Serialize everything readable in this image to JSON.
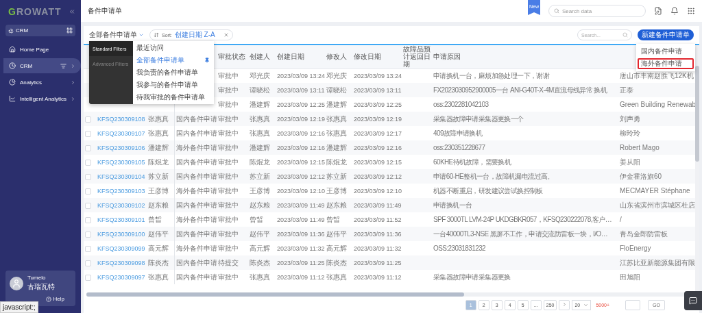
{
  "sidebar": {
    "logo_initial": "G",
    "logo_rest": "ROWATT",
    "workspace": "CRM",
    "nav": [
      {
        "label": "Home Page",
        "selected": false,
        "submenu": false
      },
      {
        "label": "CRM",
        "selected": true,
        "submenu": true
      },
      {
        "label": "Analytics",
        "selected": false,
        "submenu": true
      },
      {
        "label": "Intelligent Analytics",
        "selected": false,
        "submenu": true
      }
    ],
    "user": {
      "name": "Tumelo",
      "company": "古瑞瓦特"
    },
    "help": "Help"
  },
  "header": {
    "title": "备件申请单",
    "badge": "New",
    "search_placeholder": "Search data"
  },
  "toolbar": {
    "view": "全部备件申请单",
    "sort_label": "Sort:",
    "sort_value": "创建日期 Z-A",
    "search_placeholder": "Search...",
    "new_button": "新建备件申请单"
  },
  "filter_menu": {
    "categories": [
      {
        "label": "Standard Filters",
        "selected": true
      },
      {
        "label": "Advanced Filters",
        "selected": false
      }
    ],
    "items": [
      {
        "label": "最近访问",
        "selected": false,
        "pinned": false
      },
      {
        "label": "全部备件申请单",
        "selected": true,
        "pinned": true
      },
      {
        "label": "我负责的备件申请单",
        "selected": false,
        "pinned": false
      },
      {
        "label": "我参与的备件申请单",
        "selected": false,
        "pinned": false
      },
      {
        "label": "待我审批的备件申请单",
        "selected": false,
        "pinned": false
      }
    ]
  },
  "new_menu": [
    {
      "label": "国内备件申请",
      "highlighted": false
    },
    {
      "label": "海外备件申请",
      "highlighted": true
    }
  ],
  "table": {
    "columns": [
      null,
      null,
      null,
      "审批状态",
      "创建人",
      "创建日期",
      "修改人",
      "修改日期",
      "故障品预计返回日期",
      "申请原因",
      null
    ],
    "rows": [
      {
        "cells": [
          null,
          null,
          null,
          "审批中",
          "邓光庆",
          "2023/03/09 13:24",
          "邓光庆",
          "2023/03/09 13:24",
          null,
          "申请换机一台，麻烦加急处理一下，谢谢",
          "唐山市丰南赵胜飞12K机"
        ]
      },
      {
        "cells": [
          null,
          null,
          null,
          "审批中",
          "谭晓松",
          "2023/03/09 13:11",
          "谭晓松",
          "2023/03/09 13:11",
          null,
          "FX2023030952900005一台 ANI-G40T-X-4M直流母线异常 换机",
          "正泰"
        ]
      },
      {
        "cells": [
          null,
          null,
          null,
          "审批中",
          "潘建辉",
          "2023/03/09 12:25",
          "潘建辉",
          "2023/03/09 12:25",
          null,
          "oss:2302281042103",
          "Green Building Renewab"
        ]
      },
      {
        "checked": false,
        "cells": [
          "KFSQ230309108",
          "张惠真",
          "国内备件申请",
          "审批中",
          "张惠真",
          "2023/03/09 12:19",
          "张惠真",
          "2023/03/09 12:19",
          null,
          "采集器故障申请采集器更换一个",
          "刘声勇"
        ]
      },
      {
        "checked": false,
        "cells": [
          "KFSQ230309107",
          "张惠真",
          "国内备件申请",
          "审批中",
          "张惠真",
          "2023/03/09 12:16",
          "张惠真",
          "2023/03/09 12:17",
          null,
          "409故障申请换机",
          "柳玲玲"
        ]
      },
      {
        "checked": false,
        "cells": [
          "KFSQ230309106",
          "潘建辉",
          "海外备件申请",
          "审批中",
          "潘建辉",
          "2023/03/09 12:16",
          "潘建辉",
          "2023/03/09 12:16",
          null,
          "oss:230351228677",
          "Robert Mago"
        ]
      },
      {
        "checked": false,
        "cells": [
          "KFSQ230309105",
          "陈焜龙",
          "国内备件申请",
          "审批中",
          "陈焜龙",
          "2023/03/09 12:15",
          "陈焜龙",
          "2023/03/09 12:15",
          null,
          "60KHE待机故障，需要换机",
          "姜从阳"
        ]
      },
      {
        "checked": false,
        "cells": [
          "KFSQ230309104",
          "苏立新",
          "国内备件申请",
          "审批中",
          "苏立新",
          "2023/03/09 12:12",
          "苏立新",
          "2023/03/09 12:12",
          null,
          "申请60-HE整机一台，故障机漏电流过高。",
          "伊金霍洛旗60"
        ]
      },
      {
        "checked": false,
        "cells": [
          "KFSQ230309103",
          "王彦博",
          "海外备件申请",
          "审批中",
          "王彦博",
          "2023/03/09 12:10",
          "王彦博",
          "2023/03/09 12:10",
          null,
          "机器不断重启，研发建议尝试换控制板",
          "MECMAYER Stéphane"
        ]
      },
      {
        "checked": false,
        "cells": [
          "KFSQ230309102",
          "赵东粮",
          "国内备件申请",
          "审批中",
          "赵东粮",
          "2023/03/09 11:49",
          "赵东粮",
          "2023/03/09 11:49",
          null,
          "申请换机一台",
          "山东省滨州市滨城区杜店"
        ]
      },
      {
        "checked": false,
        "cells": [
          "KFSQ230309101",
          "曾皙",
          "海外备件申请",
          "审批中",
          "曾皙",
          "2023/03/09 11:49",
          "曾皙",
          "2023/03/09 11:52",
          null,
          "SPF 3000TL LVM-24P UKDGBKR057，KFSQ230222078,客户…",
          "/"
        ]
      },
      {
        "checked": false,
        "cells": [
          "KFSQ230309100",
          "赵伟平",
          "国内备件申请",
          "审批中",
          "赵伟平",
          "2023/03/09 11:36",
          "赵伟平",
          "2023/03/09 11:36",
          null,
          "一台40000TL3-NSE 黑屏不工作，申请交流防雷板一块，I/O…",
          "青岛金郎防雷板"
        ]
      },
      {
        "checked": false,
        "cells": [
          "KFSQ230309099",
          "高元辉",
          "海外备件申请",
          "审批中",
          "高元辉",
          "2023/03/09 11:32",
          "高元辉",
          "2023/03/09 11:32",
          null,
          "OSS:23031831232",
          "FloEnergy"
        ]
      },
      {
        "checked": false,
        "cells": [
          "KFSQ230309098",
          "陈炎杰",
          "国内备件申请",
          "待提交",
          "陈炎杰",
          "2023/03/09 11:25",
          "陈炎杰",
          "2023/03/09 11:25",
          null,
          null,
          "江苏比亚新能源集团有限"
        ]
      },
      {
        "checked": false,
        "cells": [
          "KFSQ230309097",
          "张惠真",
          "国内备件申请",
          "审批中",
          "张惠真",
          "2023/03/09 11:12",
          "张惠真",
          "2023/03/09 11:12",
          null,
          "采集器故障申请采集器更换",
          "田旭阳"
        ]
      }
    ]
  },
  "pagination": {
    "pages": [
      {
        "label": "1",
        "selected": true
      },
      {
        "label": "2",
        "selected": false
      },
      {
        "label": "3",
        "selected": false
      },
      {
        "label": "4",
        "selected": false
      },
      {
        "label": "5",
        "selected": false
      },
      {
        "label": "...",
        "selected": false
      },
      {
        "label": "250",
        "selected": false
      }
    ],
    "page_size": "20",
    "total": "5000+",
    "go": "GO"
  },
  "status_text": "javascript:;"
}
